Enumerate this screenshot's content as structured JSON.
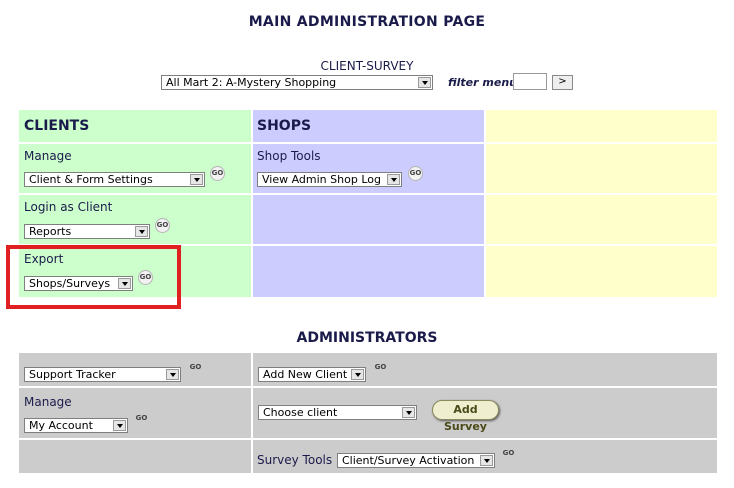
{
  "page": {
    "title": "MAIN ADMINISTRATION PAGE",
    "client_survey_label": "CLIENT-SURVEY",
    "client_survey_value": "All Mart 2: A-Mystery Shopping",
    "filter_menu_label": "filter menu",
    "filter_menu_value": "",
    "filter_go": ">"
  },
  "clients": {
    "header": "CLIENTS",
    "manage_label": "Manage",
    "manage_value": "Client & Form Settings",
    "login_label": "Login as Client",
    "login_value": "Reports",
    "export_label": "Export",
    "export_value": "Shops/Surveys"
  },
  "shops": {
    "header": "SHOPS",
    "tools_label": "Shop Tools",
    "tools_value": "View Admin Shop Log"
  },
  "administrators": {
    "header": "ADMINISTRATORS",
    "support_value": "Support Tracker",
    "add_client_value": "Add New Client",
    "manage_label": "Manage",
    "manage_value": "My Account",
    "choose_client_value": "Choose client",
    "add_survey_label": "Add Survey",
    "survey_tools_label": "Survey Tools",
    "survey_tools_value": "Client/Survey Activation"
  },
  "go_label": "GO",
  "colors": {
    "clients_bg": "#ccffcc",
    "shops_bg": "#ccccff",
    "third_col_bg": "#ffffcc",
    "admin_bg": "#cccccc",
    "highlight": "#e02020"
  }
}
